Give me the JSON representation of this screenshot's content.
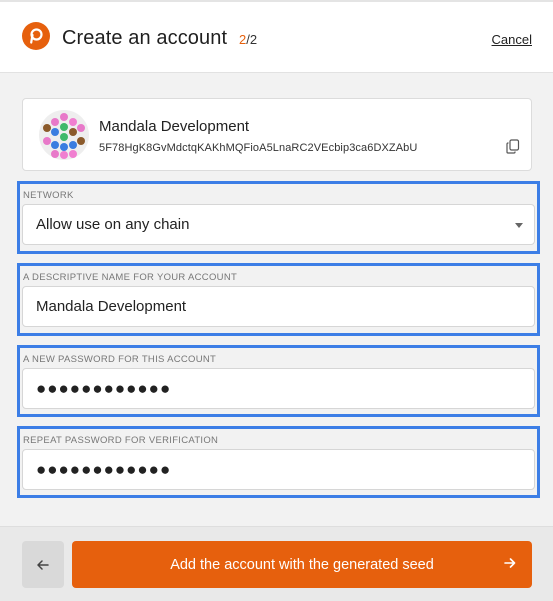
{
  "header": {
    "title": "Create an account",
    "step_current": "2",
    "step_total": "/2",
    "cancel_label": "Cancel"
  },
  "account": {
    "name": "Mandala Development",
    "address": "5F78HgK8GvMdctqKAKhMQFioA5LnaRC2VEcbip3ca6DXZAbU"
  },
  "fields": {
    "network": {
      "label": "NETWORK",
      "value": "Allow use on any chain"
    },
    "name": {
      "label": "A DESCRIPTIVE NAME FOR YOUR ACCOUNT",
      "value": "Mandala Development"
    },
    "password": {
      "label": "A NEW PASSWORD FOR THIS ACCOUNT",
      "value": "●●●●●●●●●●●●"
    },
    "repeat": {
      "label": "REPEAT PASSWORD FOR VERIFICATION",
      "value": "●●●●●●●●●●●●"
    }
  },
  "footer": {
    "back_icon": "arrow-left-icon",
    "submit_label": "Add the account with the generated seed",
    "submit_icon": "arrow-right-icon"
  },
  "colors": {
    "accent": "#e6600d",
    "focus_outline": "#3c7ee6"
  }
}
